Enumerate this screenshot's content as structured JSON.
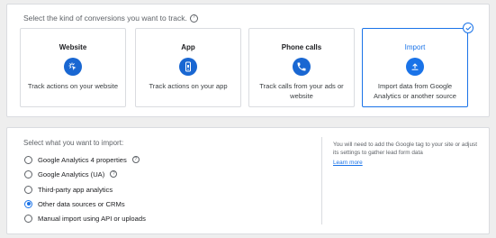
{
  "conversion_section": {
    "heading": "Select the kind of conversions you want to track.",
    "help_glyph": "?",
    "cards": [
      {
        "title": "Website",
        "icon": "cursor-click-icon",
        "description": "Track actions on your website"
      },
      {
        "title": "App",
        "icon": "phone-app-icon",
        "description": "Track actions on your app"
      },
      {
        "title": "Phone calls",
        "icon": "phone-icon",
        "description": "Track calls from your ads or website"
      },
      {
        "title": "Import",
        "icon": "upload-icon",
        "description": "Import data from Google Analytics or another source",
        "selected": true
      }
    ]
  },
  "import_section": {
    "heading": "Select what you want to import:",
    "options": [
      {
        "label": "Google Analytics 4 properties",
        "has_help": true,
        "checked": false
      },
      {
        "label": "Google Analytics (UA)",
        "has_help": true,
        "checked": false
      },
      {
        "label": "Third-party app analytics",
        "has_help": false,
        "checked": false
      },
      {
        "label": "Other data sources or CRMs",
        "has_help": false,
        "checked": true
      },
      {
        "label": "Manual import using API or uploads",
        "has_help": false,
        "checked": false
      }
    ],
    "info_text": "You will need to add the Google tag to your site or adjust its settings to gather lead form data",
    "learn_more": "Learn more"
  },
  "colors": {
    "accent": "#1a73e8",
    "icon_bg": "#1967d2",
    "border": "#dadce0",
    "page_bg": "#eeeeee"
  }
}
